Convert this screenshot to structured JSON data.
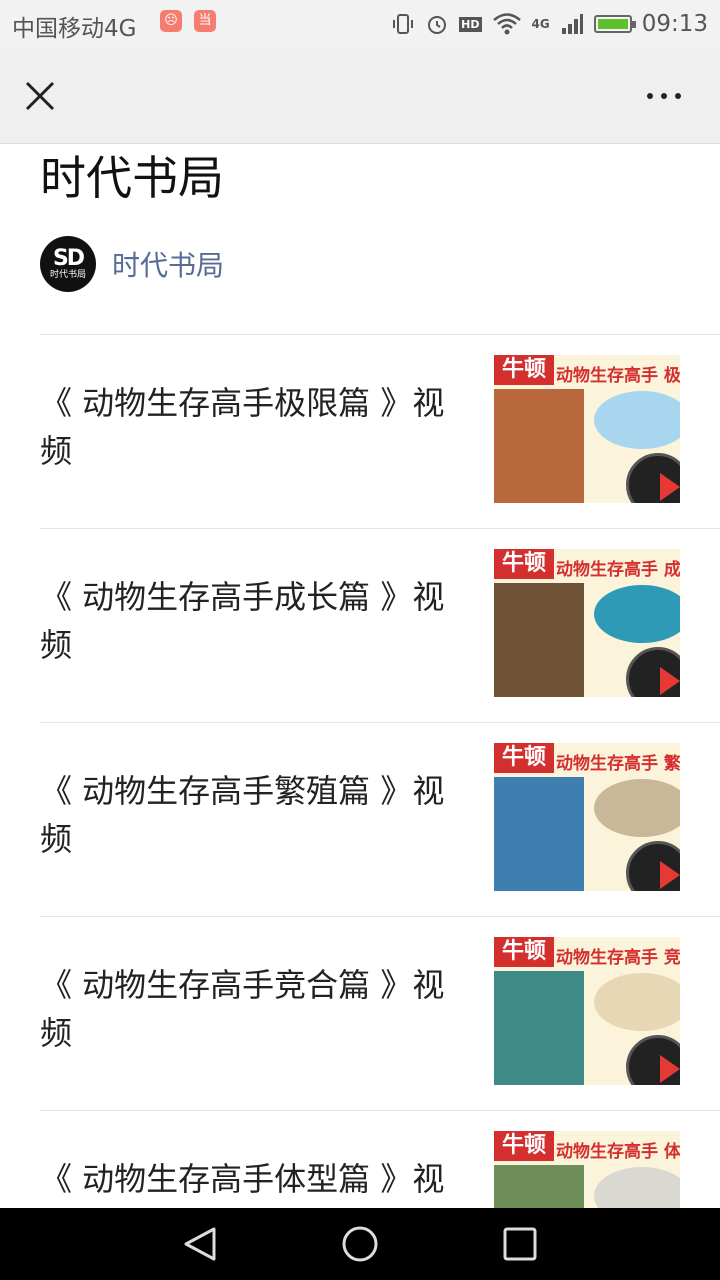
{
  "status_bar": {
    "carrier": "中国移动4G",
    "network": "4G",
    "hd": "HD",
    "time": "09:13",
    "badge_one": "☹",
    "badge_two": "当",
    "battery_level": 1.0
  },
  "nav": {
    "close_icon": "close-icon",
    "more_icon": "more-icon"
  },
  "page": {
    "title": "时代书局"
  },
  "account": {
    "name": "时代书局",
    "avatar_mark": "SD",
    "avatar_text": "时代书局"
  },
  "articles": [
    {
      "title": "《 动物生存高手极限篇 》视频",
      "thumb_brand": "牛顿",
      "thumb_series": "动物生存高手 极",
      "book_color": "#b8683c",
      "oval_color": "#a9d6ef"
    },
    {
      "title": "《 动物生存高手成长篇 》视频",
      "thumb_brand": "牛顿",
      "thumb_series": "动物生存高手 成",
      "book_color": "#6f5236",
      "oval_color": "#2f9ab5"
    },
    {
      "title": "《 动物生存高手繁殖篇 》视频",
      "thumb_brand": "牛顿",
      "thumb_series": "动物生存高手 繁",
      "book_color": "#3f7fb0",
      "oval_color": "#c9b79a"
    },
    {
      "title": "《 动物生存高手竞合篇 》视频",
      "thumb_brand": "牛顿",
      "thumb_series": "动物生存高手 竞",
      "book_color": "#3e8a86",
      "oval_color": "#e8d7b5"
    },
    {
      "title": "《 动物生存高手体型篇 》视",
      "thumb_brand": "牛顿",
      "thumb_series": "动物生存高手 体",
      "book_color": "#6e8f5a",
      "oval_color": "#d9d9d2"
    }
  ],
  "android_nav": {
    "back_icon": "back-icon",
    "home_icon": "home-icon",
    "recent_icon": "recent-apps-icon"
  }
}
